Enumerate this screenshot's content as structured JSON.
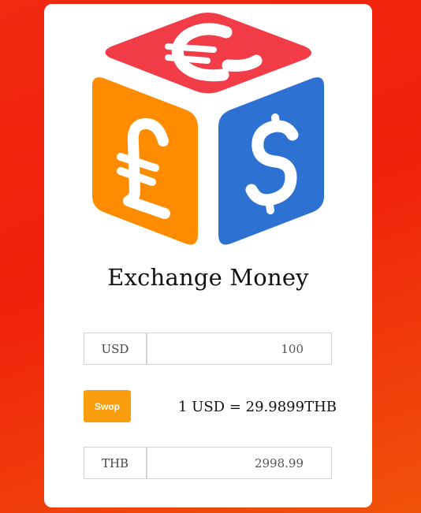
{
  "app": {
    "title": "Exchange Money"
  },
  "logo": {
    "icons": [
      "euro-icon",
      "pound-icon",
      "dollar-icon"
    ],
    "colors": {
      "top": "#f23c48",
      "left": "#ff8c00",
      "right": "#2d72d2"
    }
  },
  "from": {
    "currency": "USD",
    "amount": "100"
  },
  "swap": {
    "label": "Swop",
    "color": "#fa9d0e"
  },
  "rate": {
    "text": "1 USD = 29.9899THB"
  },
  "to": {
    "currency": "THB",
    "amount": "2998.99"
  },
  "colors": {
    "background": "#f1200c",
    "card": "#ffffff"
  }
}
